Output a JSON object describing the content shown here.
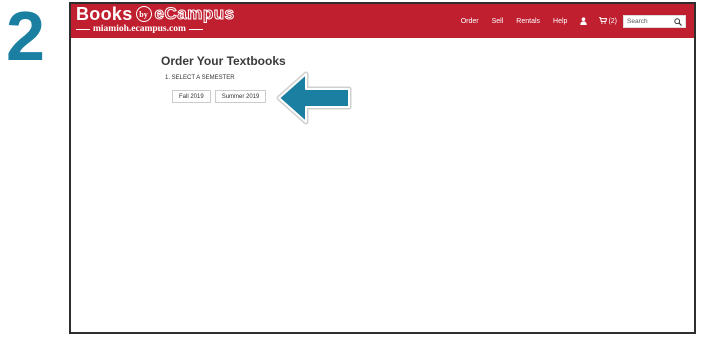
{
  "step": {
    "number": "2"
  },
  "logo": {
    "books": "Books",
    "by": "by",
    "ecampus": "eCampus",
    "subdomain": "miamioh.ecampus.com"
  },
  "nav": {
    "items": [
      {
        "label": "Order"
      },
      {
        "label": "Sell"
      },
      {
        "label": "Rentals"
      },
      {
        "label": "Help"
      }
    ],
    "account_icon": "user-icon",
    "cart_icon": "cart-icon",
    "cart_count": "(2)",
    "search_placeholder": "Search",
    "search_icon": "search-icon"
  },
  "main": {
    "title": "Order Your Textbooks",
    "section_label": "1. SELECT A SEMESTER",
    "semesters": [
      {
        "label": "Fall 2019"
      },
      {
        "label": "Summer 2019"
      }
    ]
  },
  "colors": {
    "header": "#c01f2f",
    "step_number": "#1a7fa1",
    "arrow": "#1a7fa1"
  }
}
